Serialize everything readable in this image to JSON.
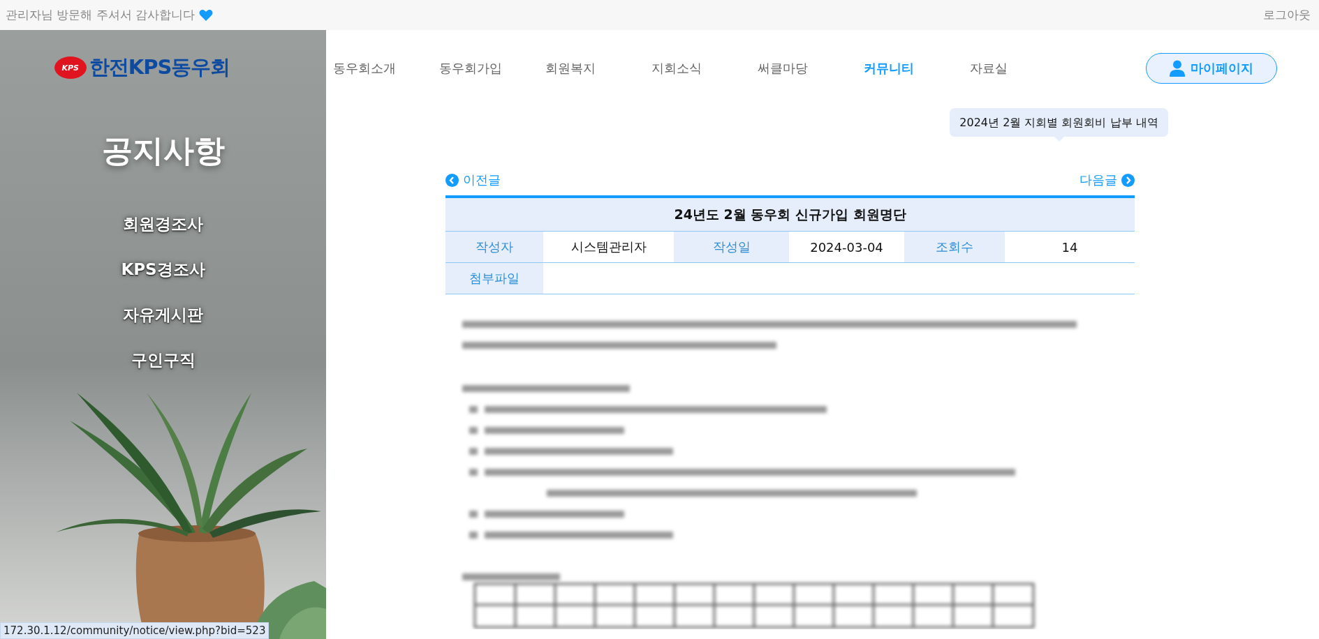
{
  "top_bar": {
    "greeting": "관리자님 방문해 주셔서 감사합니다",
    "logout": "로그아웃"
  },
  "logo": {
    "mark": "KPS",
    "name": "한전KPS동우회"
  },
  "sidebar": {
    "title": "공지사항",
    "items": [
      {
        "label": "회원경조사",
        "selected": false
      },
      {
        "label": "KPS경조사",
        "selected": false
      },
      {
        "label": "자유게시판",
        "selected": false
      },
      {
        "label": "구인구직",
        "selected": false
      }
    ]
  },
  "nav": [
    {
      "label": "동우회소개",
      "selected": false
    },
    {
      "label": "동우회가입",
      "selected": false
    },
    {
      "label": "회원복지",
      "selected": false
    },
    {
      "label": "지회소식",
      "selected": false
    },
    {
      "label": "써클마당",
      "selected": false
    },
    {
      "label": "커뮤니티",
      "selected": true
    },
    {
      "label": "자료실",
      "selected": false
    }
  ],
  "mypage_button": "마이페이지",
  "tooltip": "2024년 2월 지회별 회원회비 납부 내역",
  "prev_link": "이전글",
  "next_link": "다음글",
  "post": {
    "title": "24년도 2월 동우회 신규가입 회원명단",
    "fields": [
      {
        "label": "작성자",
        "value": "시스템관리자"
      },
      {
        "label": "작성일",
        "value": "2024-03-04"
      },
      {
        "label": "조회수",
        "value": "14"
      }
    ],
    "attachment_label": "첨부파일",
    "body": {
      "kind": "blurred"
    }
  },
  "status_url": "172.30.1.12/community/notice/view.php?bid=523"
}
